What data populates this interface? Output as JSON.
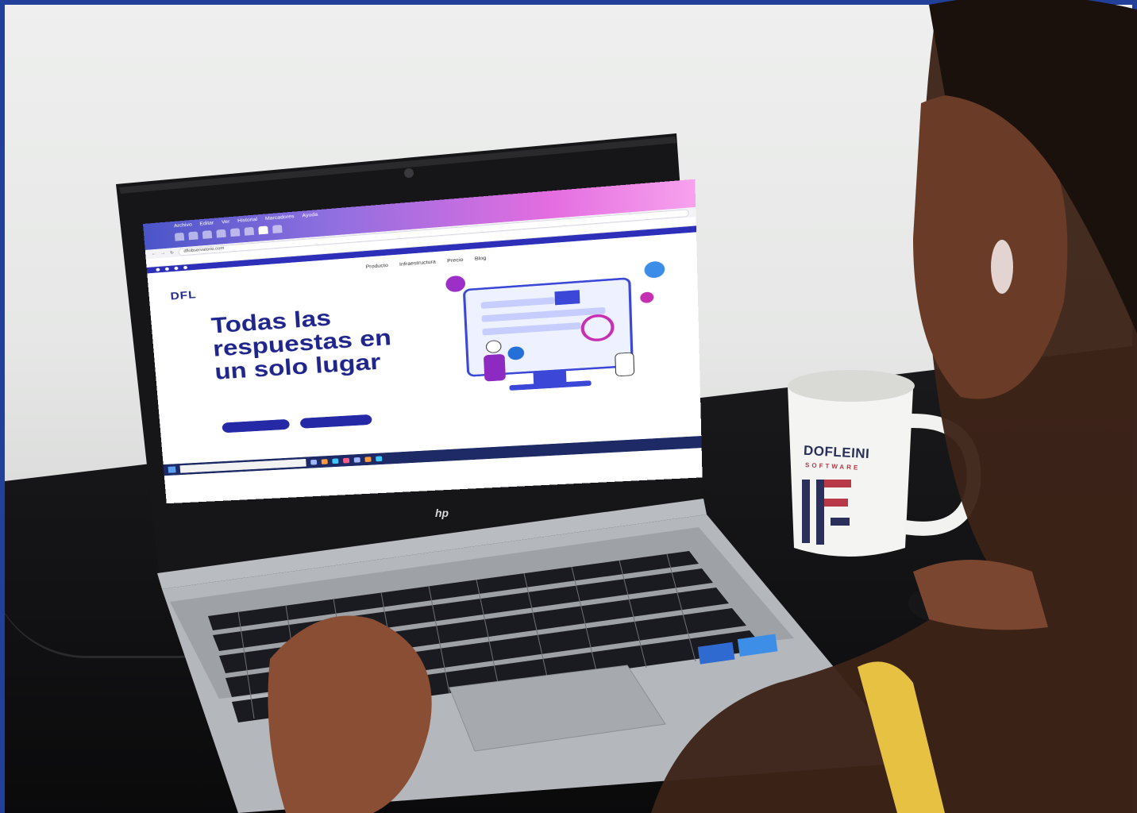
{
  "scene": {
    "description_role": "photo",
    "border_color": "#22409a"
  },
  "browser": {
    "menu": [
      "Archivo",
      "Editar",
      "Ver",
      "Historial",
      "Marcadores",
      "Ayuda"
    ],
    "tabs": [
      "",
      "",
      "",
      "",
      "",
      "",
      "",
      ""
    ],
    "url": "dflobservatorio.com",
    "bookmarks": [
      "",
      "",
      "",
      "",
      "",
      "",
      "",
      ""
    ]
  },
  "website": {
    "logo": "DFL",
    "logo_suffix": "",
    "nav": [
      "Producto",
      "Infraestructura",
      "Precio",
      "Blog"
    ],
    "hero_title": "Todas las respuestas en un solo lugar",
    "hero_subtitle": "",
    "buttons": {
      "primary": "",
      "secondary": ""
    }
  },
  "taskbar": {
    "search_placeholder": "",
    "tray_text": ""
  },
  "laptop": {
    "brand": "hp"
  },
  "mug": {
    "brand": "DOFLEINI",
    "subtitle": "SOFTWARE"
  }
}
